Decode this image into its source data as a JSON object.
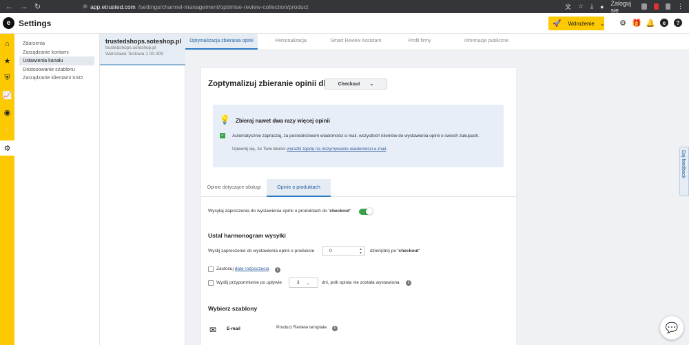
{
  "browser": {
    "url_host": "app.etrusted.com",
    "url_path": "/settings/channel-management/optimise-review-collection/product",
    "login_label": "Zaloguj się"
  },
  "header": {
    "title": "Settings",
    "onboarding_label": "Wdrożenie",
    "accent": "#fcc902"
  },
  "submenu": [
    "Zdarzenia",
    "Zarządzanie kontami",
    "Ustawienia kanału",
    "Dostosowanie szablonu",
    "Zarządzanie klientami SSO"
  ],
  "shop": {
    "name": "trustedshops.soteshop.pl",
    "domain": "trustedshops.soteshop.pl",
    "address": "Warszawa Testowa 1 00-300"
  },
  "tabs": [
    "Optymalizacja zbierania opinii",
    "Personalizacja",
    "Smart Review Assistant",
    "Profil firmy",
    "Informacje publiczne"
  ],
  "main": {
    "title": "Zoptymalizuj zbieranie opinii dla:",
    "event_select": "Checkout",
    "info_heading": "Zbieraj nawet dwa razy więcej opinii",
    "info_text": "Automatycznie zapraszaj, za pośrednictwem wiadomości e-mail, wszystkich klientów do wystawienia opinii o swoich zakupach.",
    "info_note_prefix": "Upewnij się, że Twoi klienci",
    "info_note_link": "wyrazili zgodę na otrzymywanie wiadomości e-mail",
    "info_note_suffix": ".",
    "subtabs": [
      "Opinie dotyczące obsługi",
      "Opinie o produktach"
    ],
    "send_toggle_prefix": "Wysyłaj zaproszenia do wystawienia opinii o produktach do",
    "send_toggle_event": "'checkout'",
    "schedule_heading": "Ustal harmonogram wysyłki",
    "send_after_label": "Wyślij zaproszenie do wystawienia opinii o produkcie",
    "send_after_value": "0",
    "send_after_suffix_prefix": "dzień(dni) po",
    "send_after_suffix_event": "'checkout'",
    "apply_label": "Zastosuj",
    "apply_link": "datę rozpoczęcia",
    "reminder_label": "Wyślij przypomnienie po upływie",
    "reminder_value": "3",
    "reminder_suffix": "dni, jeśli opinia nie została wystawiona",
    "templates_heading": "Wybierz szablony",
    "template_channel": "E-mail",
    "template_name": "Product Review template"
  },
  "feedback_label": "Daj feedback"
}
